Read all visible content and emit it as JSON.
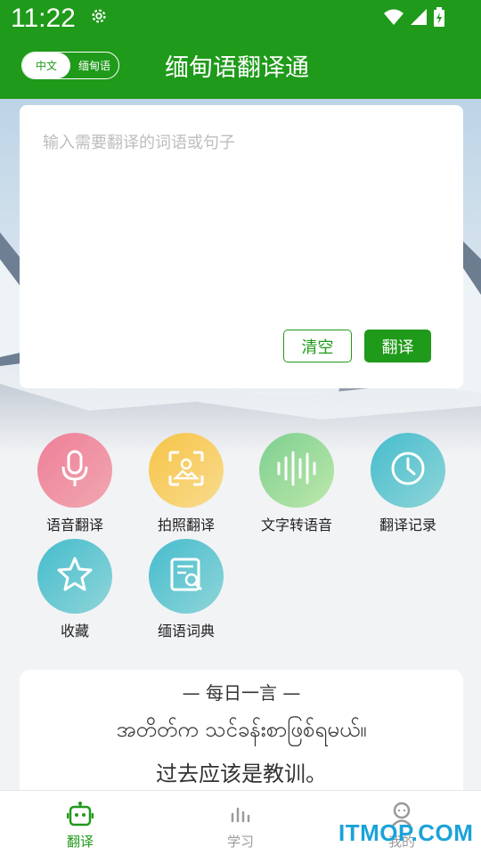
{
  "status_bar": {
    "time": "11:22",
    "icons": [
      "gear-icon",
      "wifi-icon",
      "signal-icon",
      "battery-charging-icon"
    ]
  },
  "header": {
    "lang_toggle": {
      "left": "中文",
      "right": "缅甸语",
      "selected": "中文"
    },
    "title": "缅甸语翻译通"
  },
  "input_card": {
    "placeholder": "输入需要翻译的词语或句子",
    "value": "",
    "clear_label": "清空",
    "translate_label": "翻译"
  },
  "features": [
    {
      "label": "语音翻译",
      "icon": "microphone-icon",
      "color_from": "#f08aa0",
      "color_to": "#ee9aa6"
    },
    {
      "label": "拍照翻译",
      "icon": "photo-scan-icon",
      "color_from": "#f7c84a",
      "color_to": "#f8d98a"
    },
    {
      "label": "文字转语音",
      "icon": "sound-wave-icon",
      "color_from": "#8bd49b",
      "color_to": "#b6e7a8"
    },
    {
      "label": "翻译记录",
      "icon": "clock-icon",
      "color_from": "#4fbfcf",
      "color_to": "#86d3d6"
    },
    {
      "label": "收藏",
      "icon": "star-icon",
      "color_from": "#4fbfcf",
      "color_to": "#86d3d6"
    },
    {
      "label": "缅语词典",
      "icon": "dictionary-search-icon",
      "color_from": "#4fbfcf",
      "color_to": "#86d3d6"
    }
  ],
  "quote": {
    "title": "— 每日一言 —",
    "myanmar": "အတိတ်က သင်ခန်းစာဖြစ်ရမယ်။",
    "chinese": "过去应该是教训。"
  },
  "bottom_nav": [
    {
      "label": "翻译",
      "icon": "robot-icon",
      "active": true
    },
    {
      "label": "学习",
      "icon": "bar-chart-icon",
      "active": false
    },
    {
      "label": "我的",
      "icon": "user-icon",
      "active": false
    }
  ],
  "watermark": "ITMOP.COM",
  "colors": {
    "brand": "#1f9a1a",
    "background": "#f2f3f5",
    "watermark": "#1aa3d8"
  }
}
